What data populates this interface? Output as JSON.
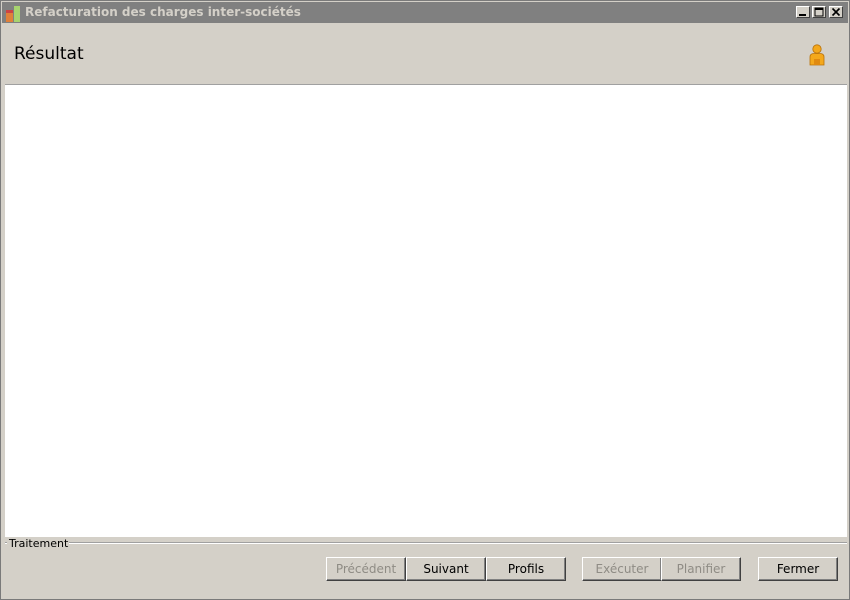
{
  "window": {
    "title": "Refacturation des charges inter-sociétés"
  },
  "header": {
    "title": "Résultat",
    "user_icon": "user-icon"
  },
  "group": {
    "label": "Traitement"
  },
  "buttons": {
    "previous": "Précédent",
    "next": "Suivant",
    "profiles": "Profils",
    "execute": "Exécuter",
    "plan": "Planifier",
    "close": "Fermer"
  },
  "colors": {
    "titlebar": "#808080",
    "window_bg": "#d4d0c8",
    "content_bg": "#ffffff",
    "disabled_text": "#8f8c85",
    "user_icon": "#f0a020"
  }
}
